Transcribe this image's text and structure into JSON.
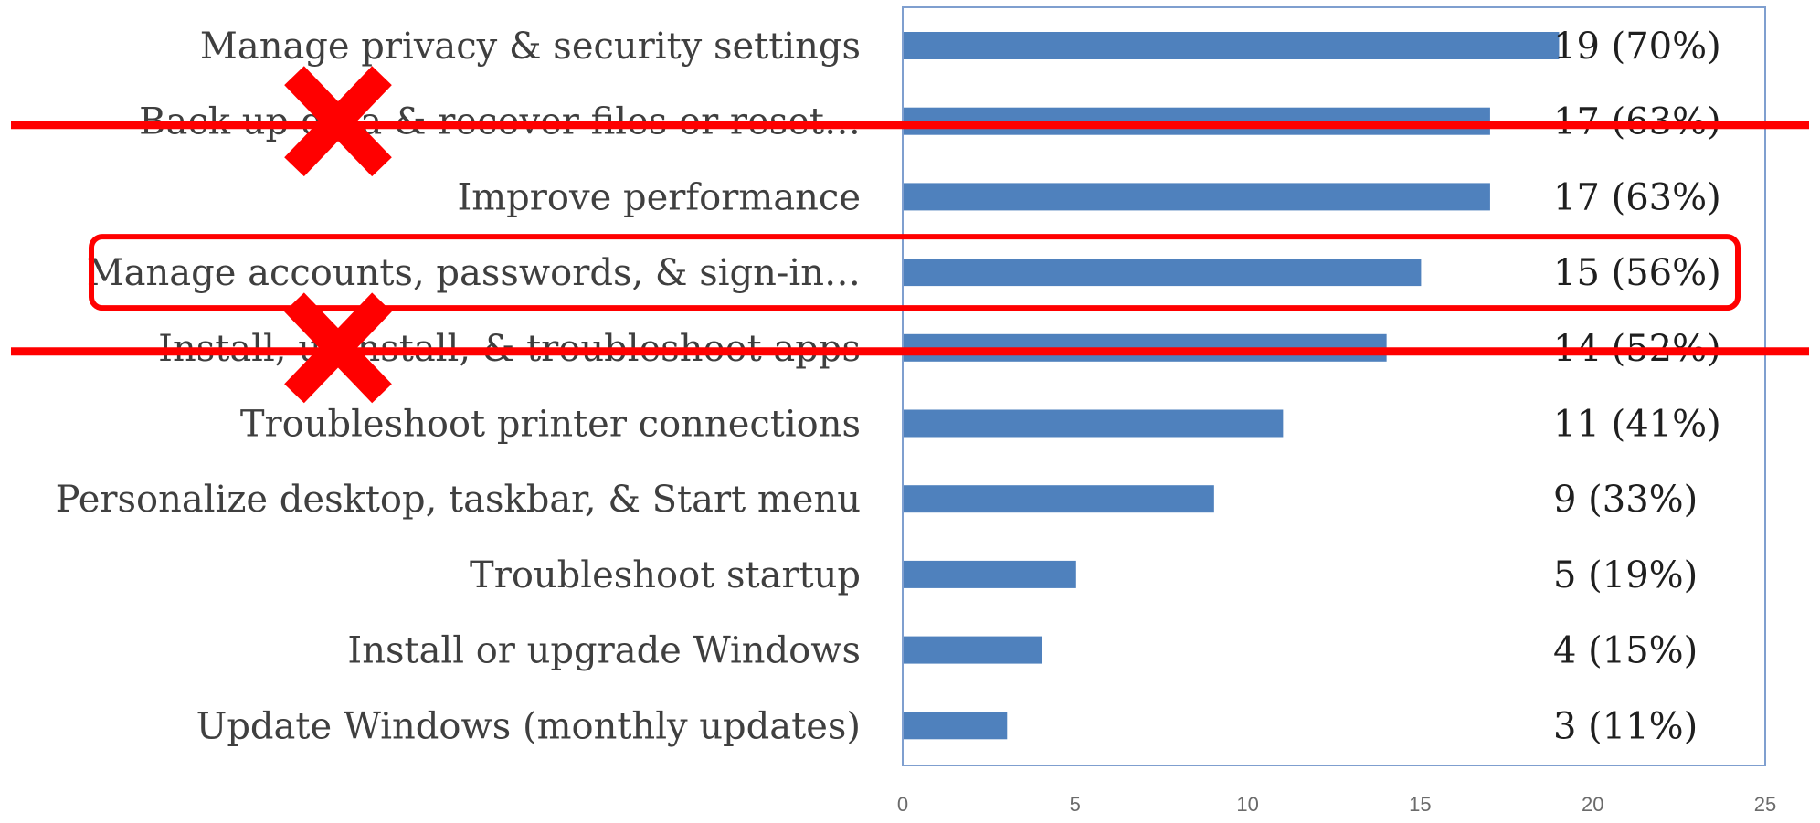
{
  "chart_data": {
    "type": "bar",
    "orientation": "horizontal",
    "categories": [
      "Manage privacy & security settings",
      "Back up data & recover files or reset…",
      "Improve performance",
      "Manage accounts, passwords, & sign-in…",
      "Install, uninstall, & troubleshoot apps",
      "Troubleshoot printer connections",
      "Personalize desktop, taskbar, & Start menu",
      "Troubleshoot startup",
      "Install or upgrade Windows",
      "Update Windows (monthly updates)"
    ],
    "values": [
      19,
      17,
      17,
      15,
      14,
      11,
      9,
      5,
      4,
      3
    ],
    "data_labels": [
      "19 (70%)",
      "17 (63%)",
      "17 (63%)",
      "15 (56%)",
      "14 (52%)",
      "11 (41%)",
      "9 (33%)",
      "5 (19%)",
      "4 (15%)",
      "3 (11%)"
    ],
    "x_ticks": [
      "0",
      "5",
      "10",
      "15",
      "20",
      "25"
    ],
    "xlim": [
      0,
      25
    ],
    "grid": false,
    "bar_color": "#4f81bd",
    "axis_color": "#7f9fcf",
    "annotations": {
      "crossed_out": [
        1,
        4
      ],
      "highlighted": [
        3
      ],
      "annotation_color": "#ff0000"
    }
  }
}
